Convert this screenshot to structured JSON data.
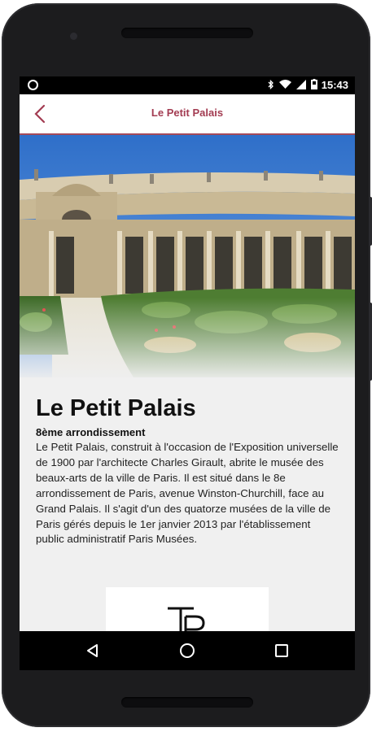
{
  "status_bar": {
    "time": "15:43",
    "icons": [
      "bluetooth-icon",
      "wifi-icon",
      "signal-icon",
      "battery-icon"
    ]
  },
  "app_bar": {
    "title": "Le Petit Palais",
    "back_icon": "chevron-left-icon",
    "accent_color": "#a33c52"
  },
  "article": {
    "title": "Le Petit Palais",
    "subtitle": "8ème arrondissement",
    "description": "Le Petit Palais, construit à l'occasion de l'Exposition universelle de 1900 par l'architecte Charles Girault, abrite le musée des beaux-arts de la ville de Paris. Il est situé dans le 8e arrondissement de Paris, avenue Winston-Churchill, face au Grand Palais. Il s'agit d'un des quatorze musées de la ville de Paris gérés depuis le 1er janvier 2013 par l'établissement public administratif Paris Musées."
  },
  "nav_bar": {
    "buttons": [
      "back-triangle-icon",
      "home-circle-icon",
      "recents-square-icon"
    ]
  }
}
